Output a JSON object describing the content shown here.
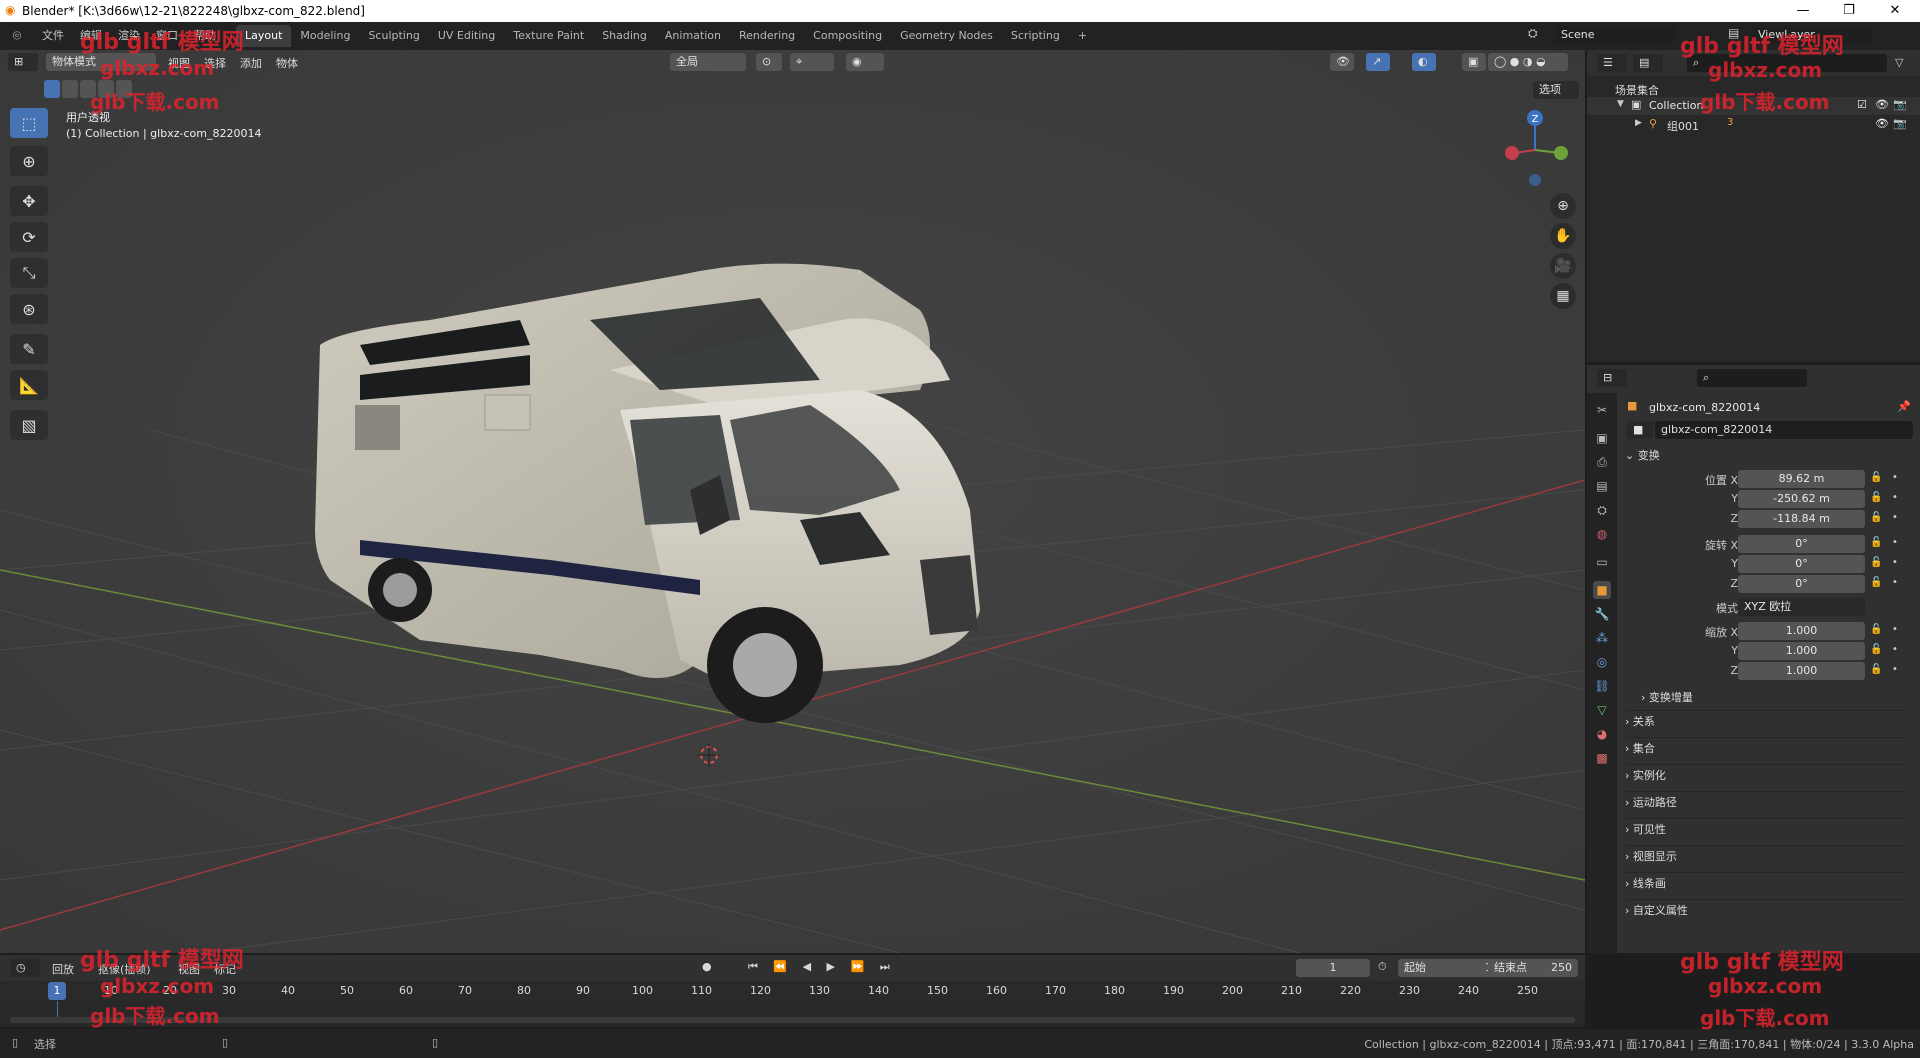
{
  "titlebar": {
    "title": "Blender* [K:\\3d66w\\12-21\\822248\\glbxz-com_822.blend]",
    "minimize": "—",
    "restore": "❐",
    "close": "✕"
  },
  "menu": [
    "文件",
    "编辑",
    "渲染",
    "窗口",
    "帮助"
  ],
  "workspaces": [
    "Layout",
    "Modeling",
    "Sculpting",
    "UV Editing",
    "Texture Paint",
    "Shading",
    "Animation",
    "Rendering",
    "Compositing",
    "Geometry Nodes",
    "Scripting"
  ],
  "add_workspace": "+",
  "scene": {
    "name": "Scene",
    "view_layer": "ViewLayer"
  },
  "viewport": {
    "mode": "物体模式",
    "menus": [
      "视图",
      "选择",
      "添加",
      "物体"
    ],
    "transform_orientation": "全局",
    "options_label": "选项",
    "view_label": "用户透视",
    "collection_label": "(1) Collection | glbxz-com_8220014",
    "gizmo_axis_z": "Z"
  },
  "tools": [
    "select-box",
    "cursor",
    "move",
    "rotate",
    "scale",
    "transform",
    "annotate",
    "measure",
    "add-cube"
  ],
  "outliner": {
    "root": "场景集合",
    "collection": "Collection",
    "child": "组001",
    "child_badge": "3"
  },
  "properties": {
    "object_name": "glbxz-com_8220014",
    "data_name": "glbxz-com_8220014",
    "transform_section": "变换",
    "location_label": "位置 X",
    "location": [
      "89.62 m",
      "-250.62 m",
      "-118.84 m"
    ],
    "rotation_label": "旋转 X",
    "rotation": [
      "0°",
      "0°",
      "0°"
    ],
    "mode_label": "模式",
    "mode_value": "XYZ 欧拉",
    "scale_label": "缩放 X",
    "scale": [
      "1.000",
      "1.000",
      "1.000"
    ],
    "axis_y": "Y",
    "axis_z": "Z",
    "delta_section": "变换增量",
    "sections": [
      "关系",
      "集合",
      "实例化",
      "运动路径",
      "可见性",
      "视图显示",
      "线条画",
      "自定义属性"
    ]
  },
  "timeline": {
    "menus": [
      "回放",
      "抠像(插帧)",
      "视图",
      "标记"
    ],
    "current_frame": "1",
    "start_label": "起始",
    "start": "1",
    "end_label": "结束点",
    "end": "250",
    "ticks": [
      "10",
      "20",
      "30",
      "40",
      "50",
      "60",
      "70",
      "80",
      "90",
      "100",
      "110",
      "120",
      "130",
      "140",
      "150",
      "160",
      "170",
      "180",
      "190",
      "200",
      "210",
      "220",
      "230",
      "240",
      "250"
    ],
    "playhead": "1"
  },
  "status": {
    "left": "选择",
    "right": "Collection | glbxz-com_8220014 | 顶点:93,471 | 面:170,841 | 三角面:170,841 | 物体:0/24 | 3.3.0 Alpha"
  },
  "watermarks": {
    "line1": "glb gltf 模型网",
    "line2": "glbxz.com",
    "line3": "glb下载.com"
  }
}
